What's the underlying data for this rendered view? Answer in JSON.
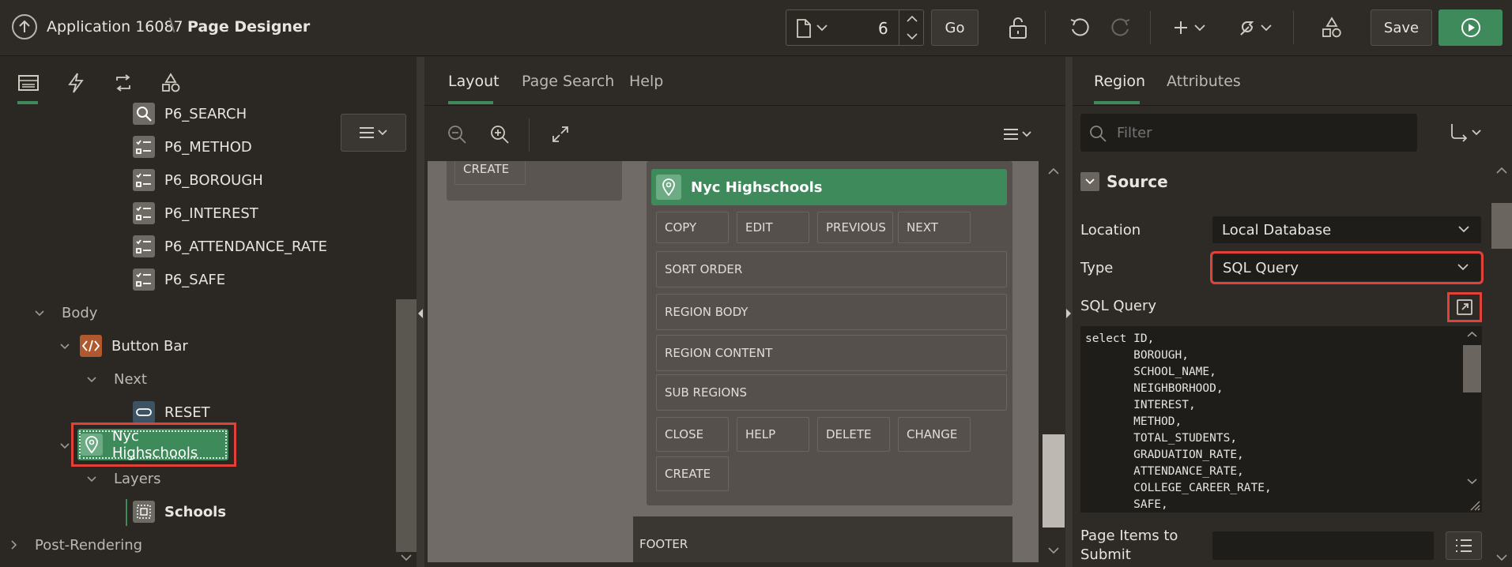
{
  "header": {
    "app_name": "Application 16087",
    "separator": "\\",
    "page_title": "Page Designer",
    "page_number": "6",
    "go_label": "Go",
    "save_label": "Save"
  },
  "left": {
    "tree": {
      "items": [
        {
          "label": "P6_SEARCH"
        },
        {
          "label": "P6_METHOD"
        },
        {
          "label": "P6_BOROUGH"
        },
        {
          "label": "P6_INTEREST"
        },
        {
          "label": "P6_ATTENDANCE_RATE"
        },
        {
          "label": "P6_SAFE"
        }
      ],
      "body_label": "Body",
      "button_bar_label": "Button Bar",
      "next_label": "Next",
      "reset_label": "RESET",
      "nyc_label": "Nyc Highschools",
      "layers_label": "Layers",
      "schools_label": "Schools",
      "post_rendering_label": "Post-Rendering"
    }
  },
  "middle": {
    "tabs": [
      "Layout",
      "Page Search",
      "Help"
    ],
    "active_tab": "Layout",
    "region_title": "Nyc Highschools",
    "top_create": "CREATE",
    "row1": [
      "COPY",
      "EDIT",
      "PREVIOUS",
      "NEXT"
    ],
    "sort_order": "SORT ORDER",
    "region_body": "REGION BODY",
    "region_content": "REGION CONTENT",
    "sub_regions": "SUB REGIONS",
    "row2": [
      "CLOSE",
      "HELP",
      "DELETE",
      "CHANGE"
    ],
    "create": "CREATE",
    "footer": "FOOTER"
  },
  "right": {
    "tabs": [
      "Region",
      "Attributes"
    ],
    "active_tab": "Region",
    "filter_placeholder": "Filter",
    "section_title": "Source",
    "location_label": "Location",
    "location_value": "Local Database",
    "type_label": "Type",
    "type_value": "SQL Query",
    "sql_label": "SQL Query",
    "sql_text": "select ID,\n       BOROUGH,\n       SCHOOL_NAME,\n       NEIGHBORHOOD,\n       INTEREST,\n       METHOD,\n       TOTAL_STUDENTS,\n       GRADUATION_RATE,\n       ATTENDANCE_RATE,\n       COLLEGE_CAREER_RATE,\n       SAFE,",
    "page_items_label_1": "Page Items to",
    "page_items_label_2": "Submit"
  },
  "colors": {
    "accent_green": "#3e8a5b",
    "highlight_red": "#e0423a",
    "dark_bg": "#2b2824"
  }
}
